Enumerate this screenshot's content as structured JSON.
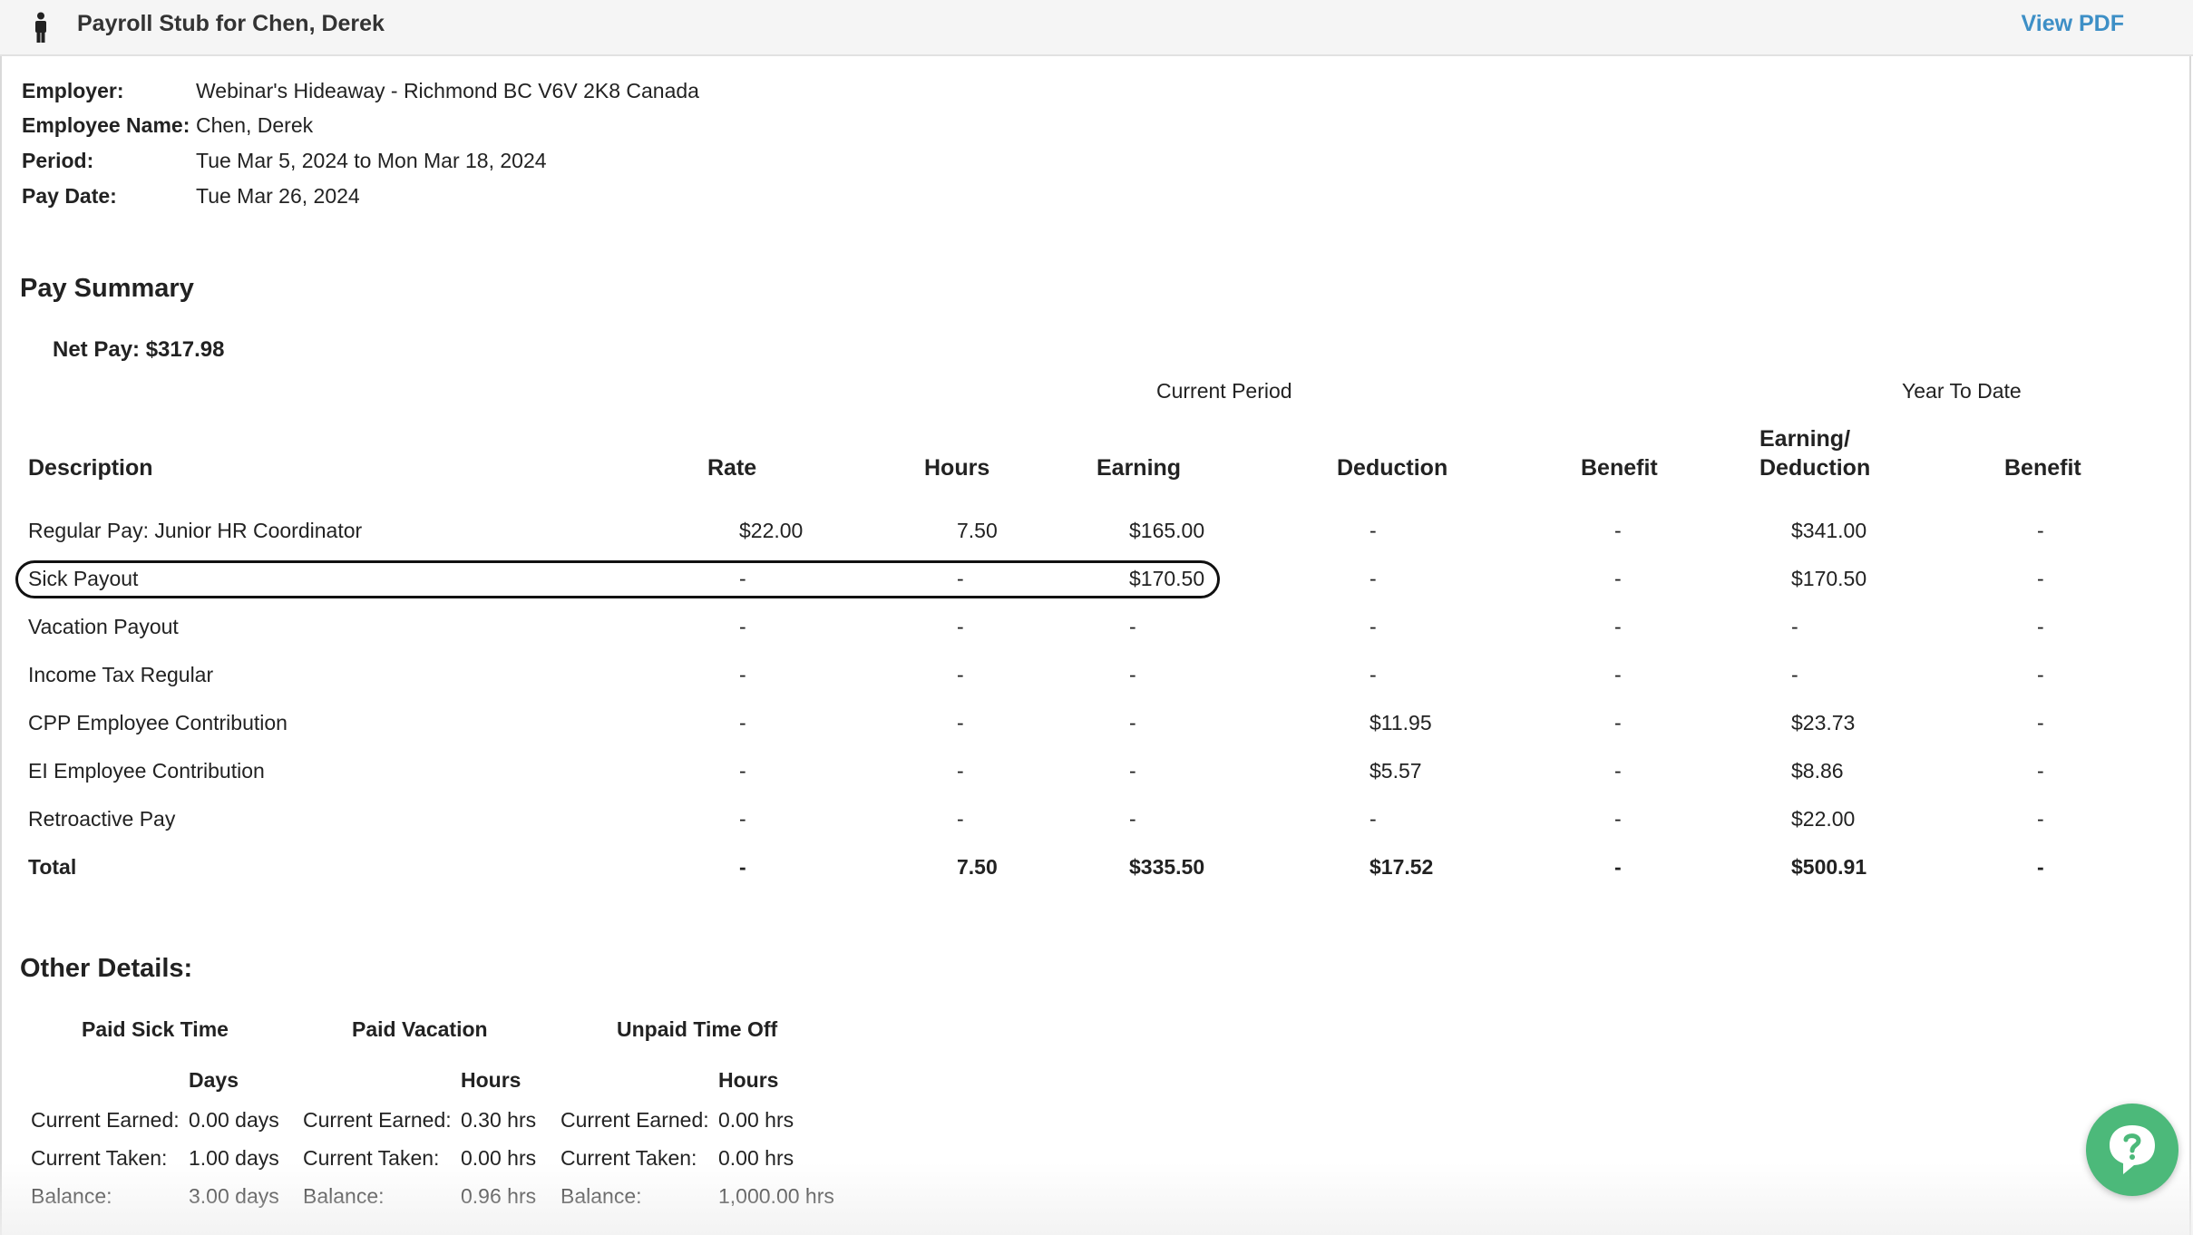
{
  "header": {
    "title": "Payroll Stub for Chen, Derek",
    "view_pdf": "View PDF"
  },
  "info": [
    {
      "label": "Employer:",
      "value": "Webinar's Hideaway - Richmond BC V6V 2K8 Canada"
    },
    {
      "label": "Employee Name:",
      "value": "Chen, Derek"
    },
    {
      "label": "Period:",
      "value": "Tue Mar 5, 2024 to Mon Mar 18, 2024"
    },
    {
      "label": "Pay Date:",
      "value": "Tue Mar 26, 2024"
    }
  ],
  "pay_summary": {
    "title": "Pay Summary",
    "net_pay": "Net Pay: $317.98",
    "group_current": "Current Period",
    "group_ytd": "Year To Date",
    "headers": {
      "description": "Description",
      "rate": "Rate",
      "hours": "Hours",
      "earning": "Earning",
      "deduction": "Deduction",
      "benefit": "Benefit",
      "ytd_earning_line1": "Earning/",
      "ytd_earning_line2": "Deduction",
      "ytd_benefit": "Benefit"
    },
    "rows": [
      {
        "description": "Regular Pay: Junior HR Coordinator",
        "rate": "$22.00",
        "hours": "7.50",
        "earning": "$165.00",
        "deduction": "-",
        "benefit": "-",
        "ytd_earning": "$341.00",
        "ytd_benefit": "-"
      },
      {
        "description": "Sick Payout",
        "rate": "-",
        "hours": "-",
        "earning": "$170.50",
        "deduction": "-",
        "benefit": "-",
        "ytd_earning": "$170.50",
        "ytd_benefit": "-"
      },
      {
        "description": "Vacation Payout",
        "rate": "-",
        "hours": "-",
        "earning": "-",
        "deduction": "-",
        "benefit": "-",
        "ytd_earning": "-",
        "ytd_benefit": "-"
      },
      {
        "description": "Income Tax Regular",
        "rate": "-",
        "hours": "-",
        "earning": "-",
        "deduction": "-",
        "benefit": "-",
        "ytd_earning": "-",
        "ytd_benefit": "-"
      },
      {
        "description": "CPP Employee Contribution",
        "rate": "-",
        "hours": "-",
        "earning": "-",
        "deduction": "$11.95",
        "benefit": "-",
        "ytd_earning": "$23.73",
        "ytd_benefit": "-"
      },
      {
        "description": "EI Employee Contribution",
        "rate": "-",
        "hours": "-",
        "earning": "-",
        "deduction": "$5.57",
        "benefit": "-",
        "ytd_earning": "$8.86",
        "ytd_benefit": "-"
      },
      {
        "description": "Retroactive Pay",
        "rate": "-",
        "hours": "-",
        "earning": "-",
        "deduction": "-",
        "benefit": "-",
        "ytd_earning": "$22.00",
        "ytd_benefit": "-"
      },
      {
        "description": "Total",
        "rate": "-",
        "hours": "7.50",
        "earning": "$335.50",
        "deduction": "$17.52",
        "benefit": "-",
        "ytd_earning": "$500.91",
        "ytd_benefit": "-"
      }
    ]
  },
  "other_details": {
    "title": "Other Details:",
    "columns": [
      {
        "title": "Paid Sick Time",
        "unit": "Days",
        "rows": [
          {
            "label": "Current Earned:",
            "value": "0.00 days"
          },
          {
            "label": "Current Taken:",
            "value": "1.00 days"
          },
          {
            "label": "Balance:",
            "value": "3.00 days"
          }
        ]
      },
      {
        "title": "Paid Vacation",
        "unit": "Hours",
        "rows": [
          {
            "label": "Current Earned:",
            "value": "0.30 hrs"
          },
          {
            "label": "Current Taken:",
            "value": "0.00 hrs"
          },
          {
            "label": "Balance:",
            "value": "0.96 hrs"
          }
        ]
      },
      {
        "title": "Unpaid Time Off",
        "unit": "Hours",
        "rows": [
          {
            "label": "Current Earned:",
            "value": "0.00 hrs"
          },
          {
            "label": "Current Taken:",
            "value": "0.00 hrs"
          },
          {
            "label": "Balance:",
            "value": "1,000.00 hrs"
          }
        ]
      }
    ]
  },
  "colors": {
    "accent_link": "#3d8fc6",
    "help_button": "#4cb97a"
  },
  "icons": {
    "person": "person-icon",
    "help": "help-chat-icon"
  }
}
